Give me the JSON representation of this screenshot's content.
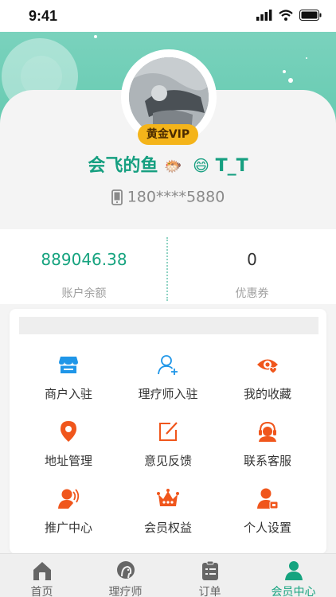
{
  "status_bar": {
    "time": "9:41"
  },
  "profile": {
    "vip_level": "黄金VIP",
    "username": "会飞的鱼",
    "emoji_1": "🐡",
    "emoji_2": "😄",
    "username_suffix": "T_T",
    "phone": "180****5880"
  },
  "stats": {
    "balance_value": "889046.38",
    "balance_label": "账户余额",
    "coupon_value": "0",
    "coupon_label": "优惠券"
  },
  "menu": [
    {
      "label": "商户入驻",
      "icon": "store-icon"
    },
    {
      "label": "理疗师入驻",
      "icon": "add-user-icon"
    },
    {
      "label": "我的收藏",
      "icon": "favorite-eye-icon"
    },
    {
      "label": "地址管理",
      "icon": "location-pin-icon"
    },
    {
      "label": "意见反馈",
      "icon": "edit-icon"
    },
    {
      "label": "联系客服",
      "icon": "customer-service-icon"
    },
    {
      "label": "推广中心",
      "icon": "promotion-icon"
    },
    {
      "label": "会员权益",
      "icon": "crown-icon"
    },
    {
      "label": "个人设置",
      "icon": "user-settings-icon"
    }
  ],
  "tabs": [
    {
      "label": "首页",
      "icon": "home-icon"
    },
    {
      "label": "理疗师",
      "icon": "therapist-icon"
    },
    {
      "label": "订单",
      "icon": "order-icon"
    },
    {
      "label": "会员中心",
      "icon": "member-icon"
    }
  ],
  "colors": {
    "brand": "#16a37f",
    "accent_orange": "#f0561c",
    "blue": "#1f96e8",
    "vip_gold": "#f4b41a"
  }
}
